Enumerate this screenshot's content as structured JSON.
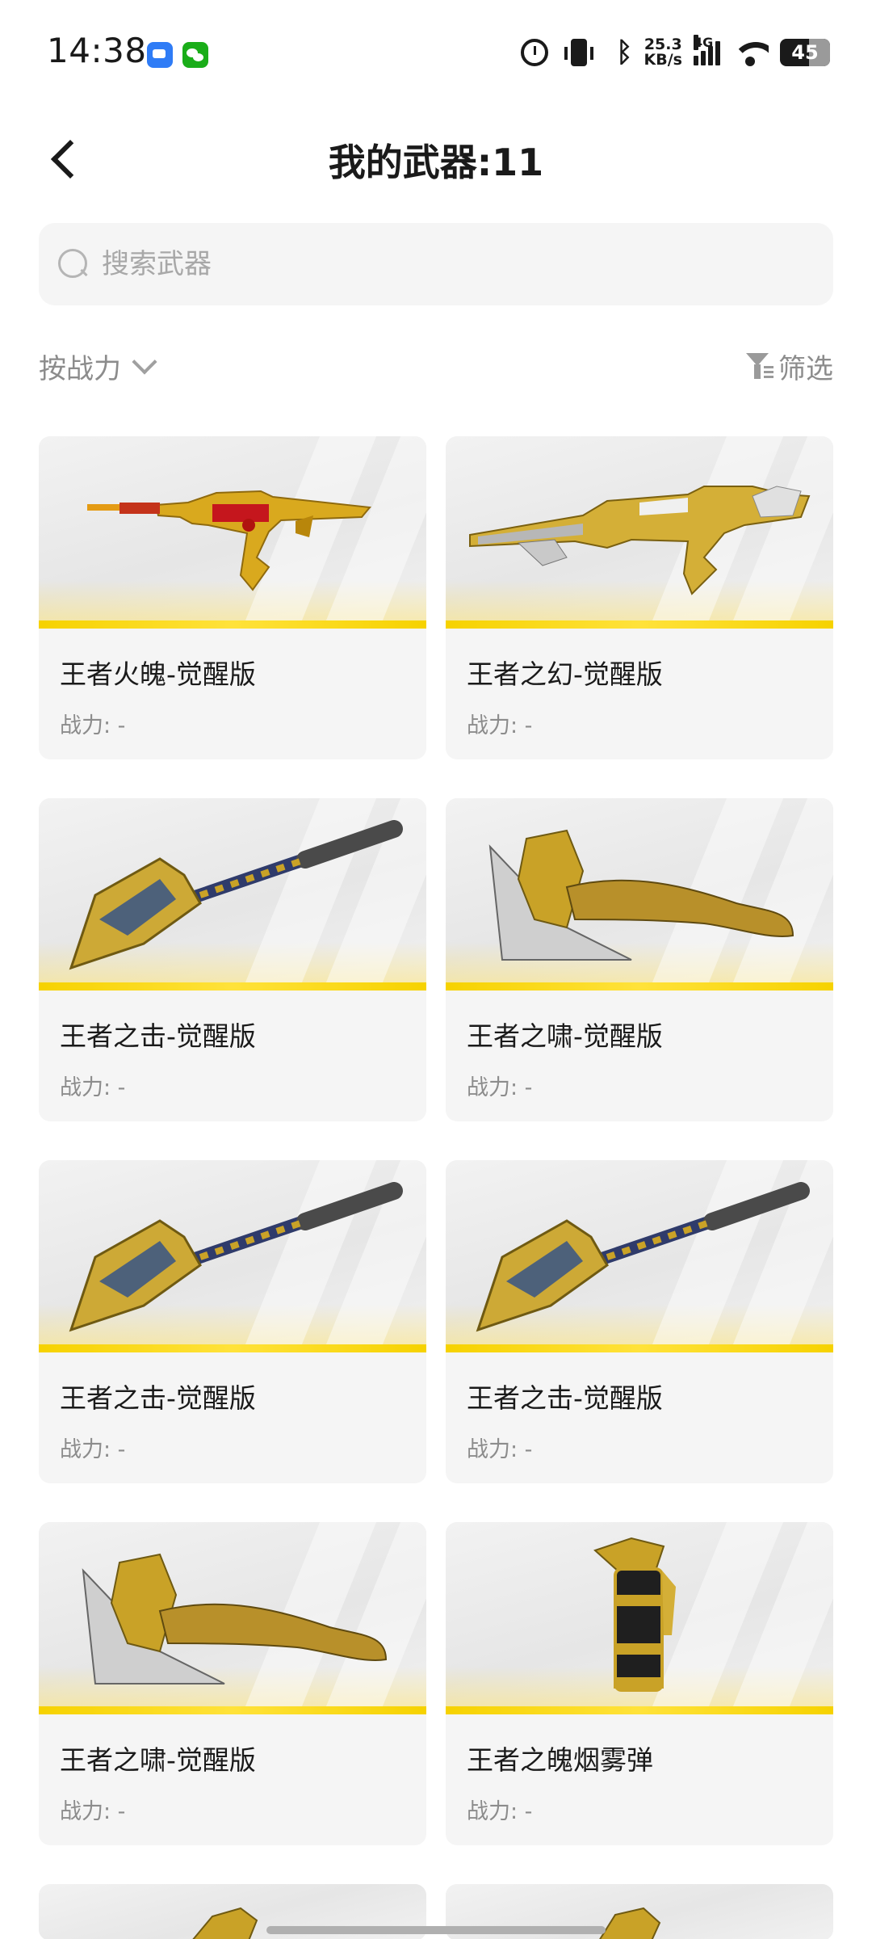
{
  "status_bar": {
    "time": "14:38",
    "net_speed_value": "25.3",
    "net_speed_unit": "KB/s",
    "network_type": "4G",
    "battery_level": "45",
    "icons": [
      "message-icon",
      "wechat-icon",
      "alarm-icon",
      "vibrate-icon",
      "bluetooth-icon",
      "signal-icon",
      "wifi-icon",
      "battery-icon"
    ]
  },
  "header": {
    "title": "我的武器:11",
    "back_icon": "chevron-left-icon"
  },
  "search": {
    "placeholder": "搜索武器",
    "value": ""
  },
  "toolbar": {
    "sort_label": "按战力",
    "filter_label": "筛选"
  },
  "weapons": [
    {
      "name": "王者火魄-觉醒版",
      "power": "战力: -",
      "kind": "rifle-red"
    },
    {
      "name": "王者之幻-觉醒版",
      "power": "战力: -",
      "kind": "rifle-silver"
    },
    {
      "name": "王者之击-觉醒版",
      "power": "战力: -",
      "kind": "shovel"
    },
    {
      "name": "王者之啸-觉醒版",
      "power": "战力: -",
      "kind": "axe"
    },
    {
      "name": "王者之击-觉醒版",
      "power": "战力: -",
      "kind": "shovel"
    },
    {
      "name": "王者之击-觉醒版",
      "power": "战力: -",
      "kind": "shovel"
    },
    {
      "name": "王者之啸-觉醒版",
      "power": "战力: -",
      "kind": "axe"
    },
    {
      "name": "王者之魄烟雾弹",
      "power": "战力: -",
      "kind": "grenade"
    }
  ],
  "colors": {
    "accent_yellow": "#f6d200",
    "card_bg": "#f5f5f5",
    "muted_text": "#8c8c8c"
  }
}
